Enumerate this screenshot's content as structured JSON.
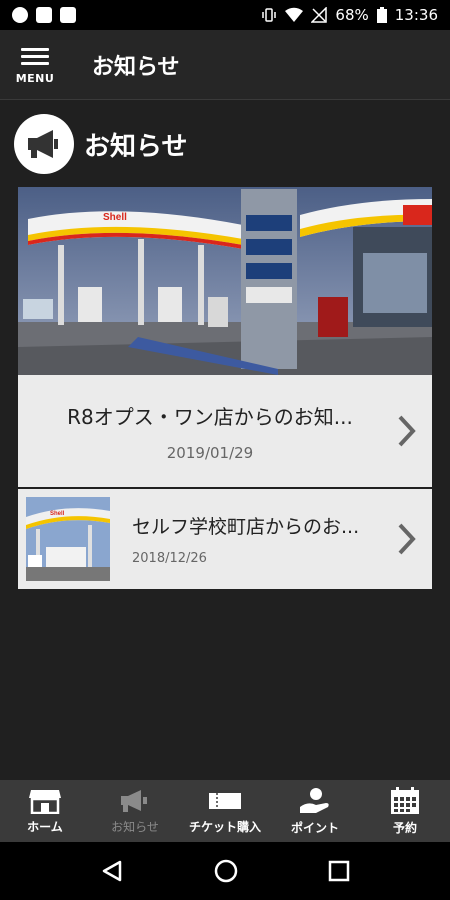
{
  "status_bar": {
    "battery": "68%",
    "time": "13:36"
  },
  "app_bar": {
    "menu_label": "MENU",
    "title": "お知らせ"
  },
  "section": {
    "title": "お知らせ",
    "icon": "megaphone-icon"
  },
  "hero_image": {
    "description_icon": "gas-station-photo"
  },
  "news": [
    {
      "title": "R8オプス・ワン店からのお知...",
      "date": "2019/01/29"
    },
    {
      "title": "セルフ学校町店からのお...",
      "date": "2018/12/26"
    }
  ],
  "tabs": [
    {
      "label": "ホーム",
      "icon": "shop-icon",
      "active": true
    },
    {
      "label": "お知らせ",
      "icon": "megaphone-icon",
      "active": false
    },
    {
      "label": "チケット購入",
      "icon": "ticket-icon",
      "active": true
    },
    {
      "label": "ポイント",
      "icon": "point-hand-icon",
      "active": true
    },
    {
      "label": "予約",
      "icon": "calendar-icon",
      "active": true
    }
  ],
  "colors": {
    "background": "#202020",
    "app_bar": "#262626",
    "tab_bar": "#3a3a3a",
    "card": "#ebebeb",
    "disabled_tab": "#8a8a8a"
  }
}
